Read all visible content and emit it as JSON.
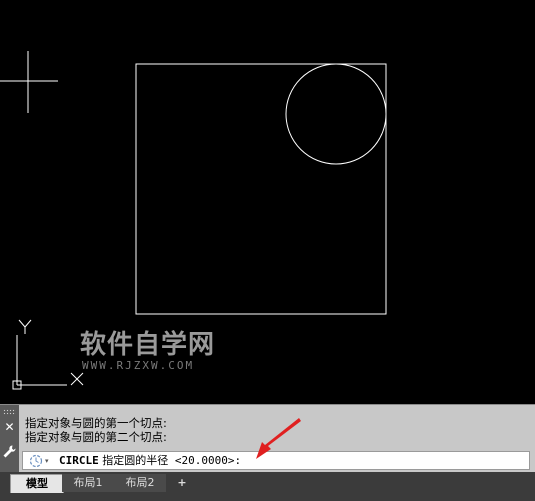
{
  "watermark": {
    "title": "软件自学网",
    "url": "WWW.RJZXW.COM"
  },
  "ucs": {
    "x_label": "X",
    "y_label": "Y"
  },
  "command_history": [
    "指定对象与圆的第一个切点:",
    "指定对象与圆的第二个切点:"
  ],
  "command_line": {
    "command": "CIRCLE",
    "prompt": "指定圆的半径 <20.0000>:",
    "dropdown_glyph": "▾"
  },
  "side_buttons": {
    "close": "✕",
    "settings": "🔧"
  },
  "tabs": {
    "model": "模型",
    "layout1": "布局1",
    "layout2": "布局2",
    "add": "+"
  },
  "colors": {
    "background": "#000000",
    "geometry": "#ffffff",
    "arrow": "#e02020",
    "crosshair": "#ffffff"
  }
}
